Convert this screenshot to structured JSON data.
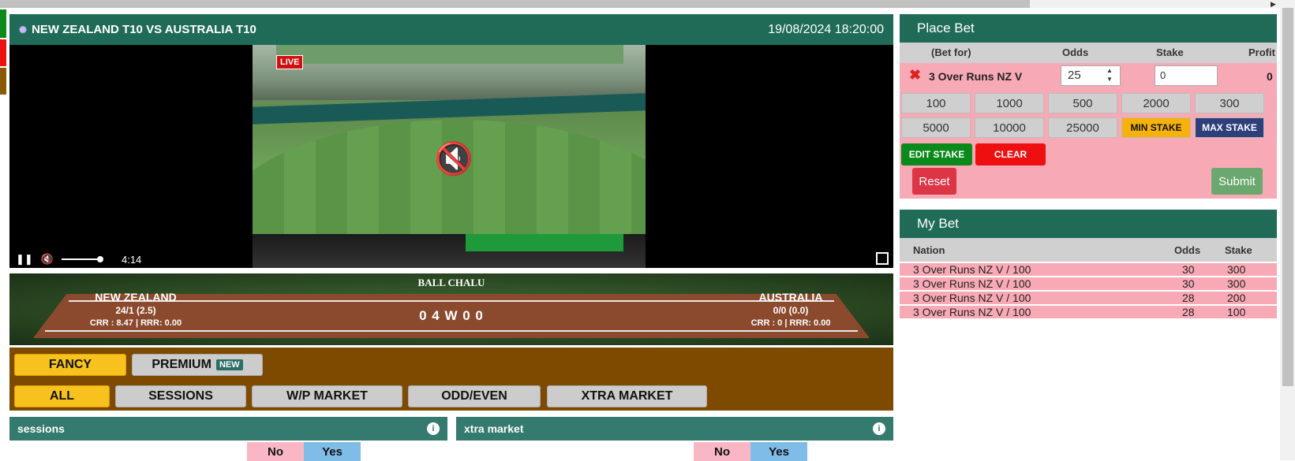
{
  "match": {
    "title": "NEW ZEALAND T10 VS AUSTRALIA T10",
    "datetime": "19/08/2024 18:20:00"
  },
  "video": {
    "live_badge": "LIVE",
    "time": "4:14"
  },
  "score": {
    "status": "BALL CHALU",
    "recent_balls": "0 4 W 0 0",
    "team1": {
      "name": "NEW ZEALAND",
      "score": "24/1 (2.5)",
      "rates": "CRR : 8.47 | RRR: 0.00"
    },
    "team2": {
      "name": "AUSTRALIA",
      "score": "0/0 (0.0)",
      "rates": "CRR : 0 | RRR: 0.00"
    }
  },
  "market_tabs": {
    "fancy": "FANCY",
    "premium": "PREMIUM",
    "premium_badge": "NEW",
    "filters": [
      "ALL",
      "SESSIONS",
      "W/P MARKET",
      "ODD/EVEN",
      "XTRA MARKET"
    ]
  },
  "markets": {
    "sessions": {
      "title": "sessions",
      "no": "No",
      "yes": "Yes"
    },
    "xtra": {
      "title": "xtra market",
      "no": "No",
      "yes": "Yes"
    }
  },
  "place_bet": {
    "title": "Place Bet",
    "columns": {
      "bet_for": "(Bet for)",
      "odds": "Odds",
      "stake": "Stake",
      "profit": "Profit"
    },
    "selection": "3 Over Runs NZ V",
    "odds_value": "25",
    "stake_value": "0",
    "profit": "0",
    "stake_buttons": [
      "100",
      "1000",
      "500",
      "2000",
      "300",
      "5000",
      "10000",
      "25000"
    ],
    "min_stake": "MIN STAKE",
    "max_stake": "MAX STAKE",
    "edit_stake": "EDIT STAKE",
    "clear": "CLEAR",
    "reset": "Reset",
    "submit": "Submit"
  },
  "my_bet": {
    "title": "My Bet",
    "columns": {
      "nation": "Nation",
      "odds": "Odds",
      "stake": "Stake"
    },
    "rows": [
      {
        "nation": "3 Over Runs NZ V / 100",
        "odds": "30",
        "stake": "300"
      },
      {
        "nation": "3 Over Runs NZ V / 100",
        "odds": "30",
        "stake": "300"
      },
      {
        "nation": "3 Over Runs NZ V / 100",
        "odds": "28",
        "stake": "200"
      },
      {
        "nation": "3 Over Runs NZ V / 100",
        "odds": "28",
        "stake": "100"
      }
    ]
  },
  "colors": {
    "header_green": "#1f6b58",
    "bet_pink": "#f8a9b6",
    "tab_brown": "#7e4a00",
    "active_yellow": "#f7c21e"
  }
}
